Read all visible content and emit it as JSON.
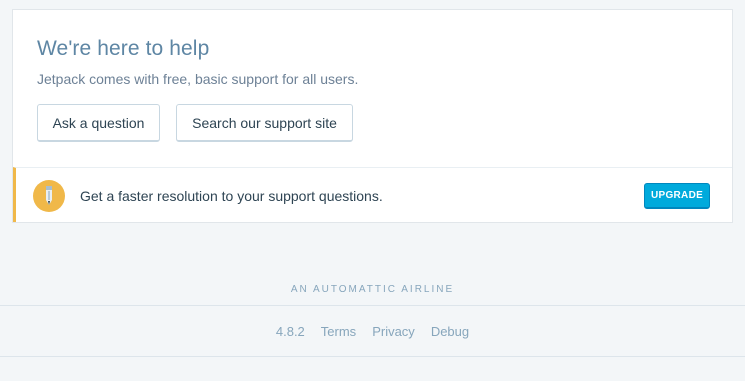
{
  "support": {
    "title": "We're here to help",
    "description": "Jetpack comes with free, basic support for all users.",
    "ask_button": "Ask a question",
    "search_button": "Search our support site"
  },
  "nudge": {
    "icon": "pencil-icon",
    "text": "Get a faster resolution to your support questions.",
    "upgrade_button": "UPGRADE"
  },
  "footer": {
    "brand": "AN AUTOMATTIC AIRLINE",
    "version": "4.8.2",
    "links": [
      "Terms",
      "Privacy",
      "Debug"
    ]
  },
  "colors": {
    "accent": "#00aadc",
    "nudge_border": "#f0b849",
    "title": "#5e86a4"
  }
}
